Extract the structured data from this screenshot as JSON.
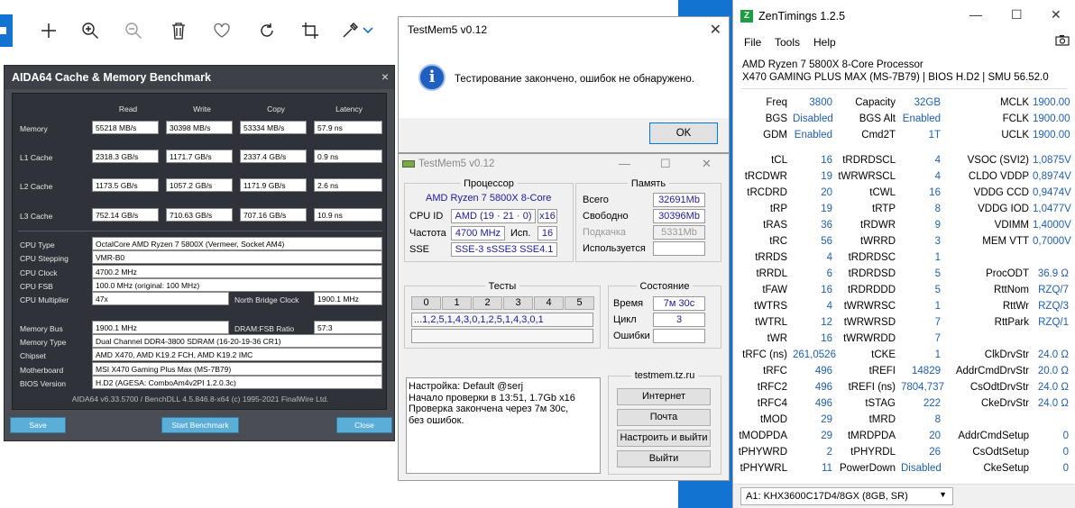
{
  "viewer": {
    "toolbar_icons": [
      "image-icon",
      "plus-icon",
      "zoom-in-icon",
      "zoom-out-icon",
      "trash-icon",
      "heart-icon",
      "rotate-icon",
      "crop-icon",
      "edit-icon",
      "chevron-down-icon"
    ]
  },
  "aida": {
    "title": "AIDA64 Cache & Memory Benchmark",
    "close": "×",
    "headers": [
      "Read",
      "Write",
      "Copy",
      "Latency"
    ],
    "rows": [
      {
        "label": "Memory",
        "read": "55218 MB/s",
        "write": "30398 MB/s",
        "copy": "53334 MB/s",
        "latency": "57.9 ns"
      },
      {
        "label": "L1 Cache",
        "read": "2318.3 GB/s",
        "write": "1171.7 GB/s",
        "copy": "2337.4 GB/s",
        "latency": "0.9 ns"
      },
      {
        "label": "L2 Cache",
        "read": "1173.5 GB/s",
        "write": "1057.2 GB/s",
        "copy": "1171.9 GB/s",
        "latency": "2.6 ns"
      },
      {
        "label": "L3 Cache",
        "read": "752.14 GB/s",
        "write": "710.63 GB/s",
        "copy": "707.16 GB/s",
        "latency": "10.9 ns"
      }
    ],
    "info": {
      "cpu_type_label": "CPU Type",
      "cpu_type": "OctalCore AMD Ryzen 7 5800X (Vermeer, Socket AM4)",
      "cpu_stepping_label": "CPU Stepping",
      "cpu_stepping": "VMR-B0",
      "cpu_clock_label": "CPU Clock",
      "cpu_clock": "4700.2 MHz",
      "cpu_fsb_label": "CPU FSB",
      "cpu_fsb": "100.0 MHz  (original: 100 MHz)",
      "cpu_mult_label": "CPU Multiplier",
      "cpu_mult": "47x",
      "nb_clock_label": "North Bridge Clock",
      "nb_clock": "1900.1 MHz",
      "mem_bus_label": "Memory Bus",
      "mem_bus": "1900.1 MHz",
      "dram_ratio_label": "DRAM:FSB Ratio",
      "dram_ratio": "57:3",
      "mem_type_label": "Memory Type",
      "mem_type": "Dual Channel DDR4-3800 SDRAM  (16-20-19-36 CR1)",
      "chipset_label": "Chipset",
      "chipset": "AMD X470, AMD K19.2 FCH, AMD K19.2 IMC",
      "motherboard_label": "Motherboard",
      "motherboard": "MSI X470 Gaming Plus Max (MS-7B79)",
      "bios_label": "BIOS Version",
      "bios": "H.D2  (AGESA: ComboAm4v2PI 1.2.0.3c)"
    },
    "footer": "AIDA64 v6.33.5700 / BenchDLL 4.5.846.8-x64  (c) 1995-2021 FinalWire Ltd.",
    "save": "Save",
    "start": "Start Benchmark",
    "close_btn": "Close"
  },
  "msgbox": {
    "title": "TestMem5 v0.12",
    "close": "✕",
    "icon": "i",
    "text": "Тестирование закончено, ошибок не обнаружено.",
    "ok": "OK"
  },
  "testmem": {
    "title": "TestMem5 v0.12",
    "cpu_group": "Процессор",
    "cpu_name": "AMD Ryzen 7 5800X 8-Core",
    "cpu_id_label": "CPU ID",
    "cpu_id": "AMD  (19 · 21 · 0)",
    "cpu_id_x": "x16",
    "freq_label": "Частота",
    "freq": "4700 MHz",
    "used_label": "Исп.",
    "used": "16",
    "sse_label": "SSE",
    "sse": "SSE-3 sSSE3 SSE4.1",
    "mem_group": "Память",
    "total_label": "Всего",
    "total": "32691Mb",
    "free_label": "Свободно",
    "free": "30396Mb",
    "swap_label": "Подкачка",
    "swap": "5331Mb",
    "used_mem_label": "Используется",
    "used_mem": "",
    "tests_group": "Тесты",
    "test_nums": [
      "0",
      "1",
      "2",
      "3",
      "4",
      "5"
    ],
    "test_seq": "...1,2,5,1,4,3,0,1,2,5,1,4,3,0,1",
    "state_group": "Состояние",
    "time_label": "Время",
    "time": "7м 30с",
    "cycle_label": "Цикл",
    "cycle": "3",
    "errors_label": "Ошибки",
    "errors": "",
    "log": "Настройка: Default @serj\nНачало проверки в 13:51, 1.7Gb x16\nПроверка закончена через 7м 30с,\nбез ошибок.",
    "site_group": "testmem.tz.ru",
    "btn_internet": "Интернет",
    "btn_mail": "Почта",
    "btn_setup": "Настроить и выйти",
    "btn_exit": "Выйти"
  },
  "zen": {
    "title": "ZenTimings 1.2.5",
    "menu": [
      "File",
      "Tools",
      "Help"
    ],
    "cpu": "AMD Ryzen 7 5800X 8-Core Processor",
    "board": "X470 GAMING PLUS MAX (MS-7B79) | BIOS H.D2 | SMU 56.52.0",
    "top": [
      [
        "Freq",
        "3800",
        "Capacity",
        "32GB",
        "MCLK",
        "1900.00"
      ],
      [
        "BGS",
        "Disabled",
        "BGS Alt",
        "Enabled",
        "FCLK",
        "1900.00"
      ],
      [
        "GDM",
        "Enabled",
        "Cmd2T",
        "1T",
        "UCLK",
        "1900.00"
      ]
    ],
    "timings": [
      [
        "tCL",
        "16",
        "tRDRDSCL",
        "4",
        "VSOC (SVI2)",
        "1,0875V"
      ],
      [
        "tRCDWR",
        "19",
        "tWRWRSCL",
        "4",
        "CLDO VDDP",
        "0,8974V"
      ],
      [
        "tRCDRD",
        "20",
        "tCWL",
        "16",
        "VDDG CCD",
        "0,9474V"
      ],
      [
        "tRP",
        "19",
        "tRTP",
        "8",
        "VDDG IOD",
        "1,0477V"
      ],
      [
        "tRAS",
        "36",
        "tRDWR",
        "9",
        "VDIMM",
        "1,4000V"
      ],
      [
        "tRC",
        "56",
        "tWRRD",
        "3",
        "MEM VTT",
        "0,7000V"
      ],
      [
        "tRRDS",
        "4",
        "tRDRDSC",
        "1",
        "",
        ""
      ],
      [
        "tRRDL",
        "6",
        "tRDRDSD",
        "5",
        "ProcODT",
        "36.9 Ω"
      ],
      [
        "tFAW",
        "16",
        "tRDRDDD",
        "5",
        "RttNom",
        "RZQ/7"
      ],
      [
        "tWTRS",
        "4",
        "tWRWRSC",
        "1",
        "RttWr",
        "RZQ/3"
      ],
      [
        "tWTRL",
        "12",
        "tWRWRSD",
        "7",
        "RttPark",
        "RZQ/1"
      ],
      [
        "tWR",
        "16",
        "tWRWRDD",
        "7",
        "",
        ""
      ],
      [
        "tRFC (ns)",
        "261,0526",
        "tCKE",
        "1",
        "ClkDrvStr",
        "24.0 Ω"
      ],
      [
        "tRFC",
        "496",
        "tREFI",
        "14829",
        "AddrCmdDrvStr",
        "20.0 Ω"
      ],
      [
        "tRFC2",
        "496",
        "tREFI (ns)",
        "7804,737",
        "CsOdtDrvStr",
        "24.0 Ω"
      ],
      [
        "tRFC4",
        "496",
        "tSTAG",
        "222",
        "CkeDrvStr",
        "24.0 Ω"
      ],
      [
        "tMOD",
        "29",
        "tMRD",
        "8",
        "",
        ""
      ],
      [
        "tMODPDA",
        "29",
        "tMRDPDA",
        "20",
        "AddrCmdSetup",
        "0"
      ],
      [
        "tPHYWRD",
        "2",
        "tPHYRDL",
        "26",
        "CsOdtSetup",
        "0"
      ],
      [
        "tPHYWRL",
        "11",
        "PowerDown",
        "Disabled",
        "CkeSetup",
        "0"
      ]
    ],
    "dimm": "A1: KHX3600C17D4/8GX (8GB, SR)"
  }
}
